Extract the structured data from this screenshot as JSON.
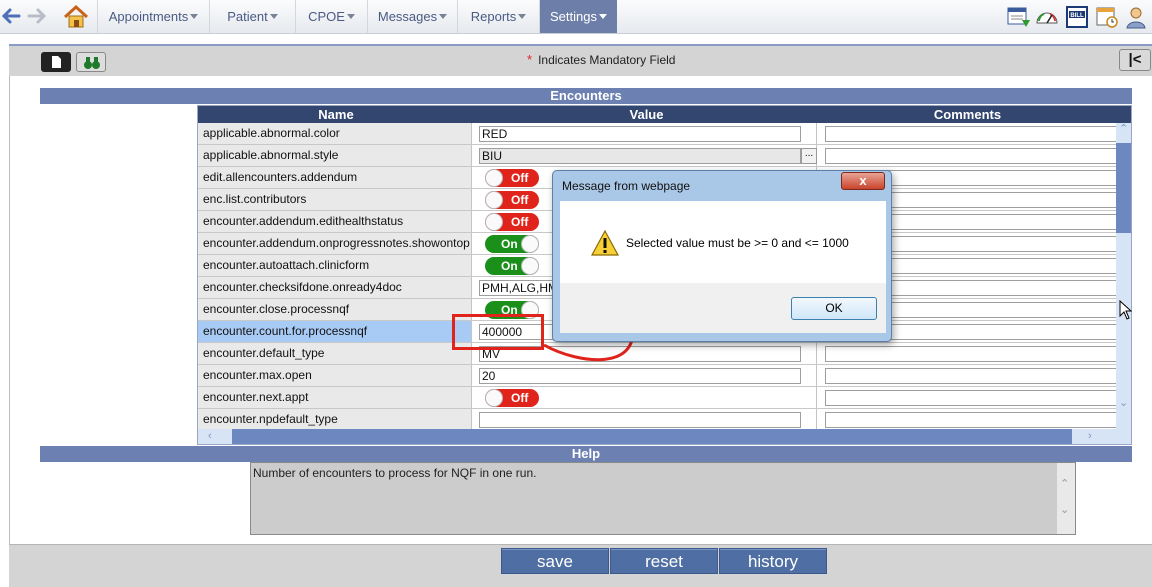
{
  "nav": {
    "menus": [
      "Appointments",
      "Patient",
      "CPOE",
      "Messages",
      "Reports",
      "Settings"
    ],
    "active": "Settings"
  },
  "toolbar": {
    "mandatory_note": "Indicates Mandatory Field",
    "mandatory_star": "*",
    "collapse_label": "|<"
  },
  "encounters": {
    "title": "Encounters",
    "columns": [
      "Name",
      "Value",
      "Comments"
    ],
    "rows": [
      {
        "name": "applicable.abnormal.color",
        "type": "text",
        "value": "RED"
      },
      {
        "name": "applicable.abnormal.style",
        "type": "text",
        "value": "BIU"
      },
      {
        "name": "edit.allencounters.addendum",
        "type": "toggle",
        "value": "Off"
      },
      {
        "name": "enc.list.contributors",
        "type": "toggle",
        "value": "Off"
      },
      {
        "name": "encounter.addendum.edithealthstatus",
        "type": "toggle",
        "value": "Off"
      },
      {
        "name": "encounter.addendum.onprogressnotes.showontop",
        "type": "toggle",
        "value": "On"
      },
      {
        "name": "encounter.autoattach.clinicform",
        "type": "toggle",
        "value": "On"
      },
      {
        "name": "encounter.checksifdone.onready4doc",
        "type": "text",
        "value": "PMH,ALG,HM"
      },
      {
        "name": "encounter.close.processnqf",
        "type": "toggle",
        "value": "On"
      },
      {
        "name": "encounter.count.for.processnqf",
        "type": "text",
        "value": "400000"
      },
      {
        "name": "encounter.default_type",
        "type": "text",
        "value": "MV"
      },
      {
        "name": "encounter.max.open",
        "type": "text",
        "value": "20"
      },
      {
        "name": "encounter.next.appt",
        "type": "toggle",
        "value": "Off"
      },
      {
        "name": "encounter.npdefault_type",
        "type": "text",
        "value": ""
      }
    ],
    "selected_row": "encounter.count.for.processnqf",
    "ellipsis_label": "..."
  },
  "help": {
    "title": "Help",
    "text": "Number of encounters to process for NQF in one run."
  },
  "buttons": {
    "save": "save",
    "reset": "reset",
    "history": "history"
  },
  "dialog": {
    "title": "Message from webpage",
    "close_label": "x",
    "message": "Selected value must be >= 0 and  <= 1000",
    "ok_label": "OK"
  },
  "colors": {
    "accent": "#6c81b2",
    "header_dark": "#33466f",
    "toggle_on": "#1a8f1a",
    "toggle_off": "#e0231b",
    "annotation": "#e0231b"
  }
}
